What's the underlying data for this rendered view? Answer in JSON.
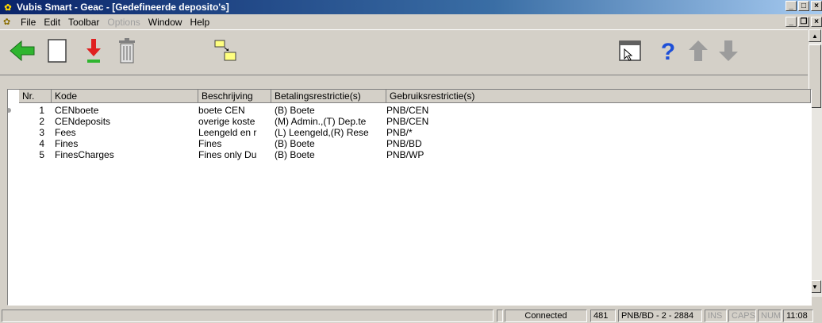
{
  "window": {
    "title": "Vubis Smart - Geac - [Gedefineerde deposito's]"
  },
  "menu": [
    {
      "label": "File",
      "disabled": false
    },
    {
      "label": "Edit",
      "disabled": false
    },
    {
      "label": "Toolbar",
      "disabled": false
    },
    {
      "label": "Options",
      "disabled": true
    },
    {
      "label": "Window",
      "disabled": false
    },
    {
      "label": "Help",
      "disabled": false
    }
  ],
  "toolbar": {
    "buttons": [
      "back-arrow-icon",
      "new-document-icon",
      "download-arrow-icon",
      "trash-icon",
      "move-folder-icon",
      "form-icon",
      "help-icon",
      "up-arrow-icon",
      "down-arrow-icon"
    ]
  },
  "table": {
    "columns": [
      "Nr.",
      "Kode",
      "Beschrijving",
      "Betalingsrestrictie(s)",
      "Gebruiksrestrictie(s)"
    ],
    "rows": [
      [
        "1",
        "CENboete",
        "boete CEN",
        "(B) Boete",
        "PNB/CEN"
      ],
      [
        "2",
        "CENdeposits",
        "overige koste",
        "(M) Admin.,(T) Dep.te",
        "PNB/CEN"
      ],
      [
        "3",
        "Fees",
        "Leengeld en r",
        "(L) Leengeld,(R) Rese",
        "PNB/*"
      ],
      [
        "4",
        "Fines",
        "Fines",
        "(B) Boete",
        "PNB/BD"
      ],
      [
        "5",
        "FinesCharges",
        "Fines only Du",
        "(B) Boete",
        "PNB/WP"
      ]
    ]
  },
  "status": {
    "connection": "Connected",
    "count": "481",
    "location": "PNB/BD - 2 - 2884",
    "ins": "INS",
    "caps": "CAPS",
    "num": "NUM",
    "time": "11:08"
  },
  "colors": {
    "titlebar": "#0a246a",
    "arrow_green": "#2fb52f",
    "arrow_red": "#e02020",
    "help_blue": "#1d4fd8",
    "arrow_grey": "#9c9c9c"
  }
}
